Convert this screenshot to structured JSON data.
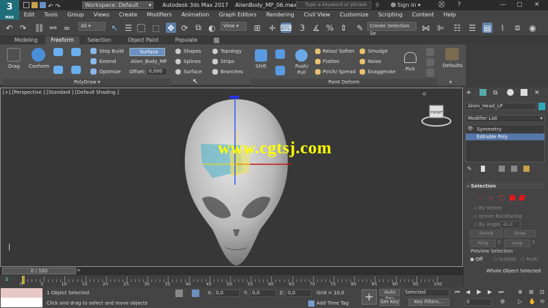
{
  "titlebar": {
    "logo": "3",
    "logo_sub": "MAX",
    "workspace": "Workspace: Default",
    "app_title": "Autodesk 3ds Max 2017",
    "file_name": "AlienBody_MP_06.max",
    "search_placeholder": "Type a keyword or phrase",
    "sign_in": "Sign In"
  },
  "menu": [
    "Edit",
    "Tools",
    "Group",
    "Views",
    "Create",
    "Modifiers",
    "Animation",
    "Graph Editors",
    "Rendering",
    "Civil View",
    "Customize",
    "Scripting",
    "Content",
    "Help"
  ],
  "toolbar": {
    "selection_filter": "All",
    "ref_coord": "View",
    "selection_set": "Create Selection Se"
  },
  "ribbon_tabs": [
    "Modeling",
    "Freeform",
    "Selection",
    "Object Paint",
    "Populate"
  ],
  "ribbon": {
    "drag": "Drag",
    "conform": "Conform",
    "step_build": "Step Build",
    "extend": "Extend",
    "optimize": "Optimize",
    "surface_btn": "Surface",
    "surface_obj": "Alien_Body_MP",
    "offset_label": "Offset:",
    "offset_value": "0,000",
    "shapes": "Shapes",
    "splines": "Splines",
    "surface2": "Surface",
    "topology": "Topology",
    "strips": "Strips",
    "branches": "Branches",
    "shift": "Shift",
    "push_pull": "Push/",
    "push_pull2": "Pull",
    "relax_soften": "Relax/ Soften",
    "flatten": "Flatten",
    "pinch_spread": "Pinch/ Spread",
    "smudge": "Smudge",
    "noise": "Noise",
    "exaggerate": "Exaggerate",
    "pick": "Pick",
    "defaults": "Defaults",
    "group_polydraw": "PolyDraw",
    "group_paint_deform": "Paint Deform"
  },
  "viewport": {
    "label": "[+] [Perspective ] [Standard ] [Default Shading ]",
    "watermark": "www.cgtsj.com",
    "cube_label": "FRONT"
  },
  "timeline": {
    "frame": "0 / 100",
    "ticks": [
      "0",
      "5",
      "10",
      "15",
      "20",
      "25",
      "30",
      "35",
      "40",
      "45",
      "50",
      "55",
      "60",
      "65",
      "70",
      "75",
      "80",
      "85",
      "90",
      "95",
      "100"
    ]
  },
  "status": {
    "selected": "1 Object Selected",
    "prompt": "Click and drag to select and move objects",
    "x_label": "X:",
    "x_val": "0,0",
    "y_label": "Y:",
    "y_val": "0,0",
    "z_label": "Z:",
    "z_val": "0,0",
    "grid": "Grid = 10,0",
    "add_time_tag": "Add Time Tag",
    "auto_key": "Auto Key",
    "selected_dd": "Selected",
    "set_key": "Set Key",
    "key_filters": "Key Filters...",
    "frame_field": "0"
  },
  "command_panel": {
    "object_name": "Alien_Head_LP",
    "modifier_list": "Modifier List",
    "stack": [
      "Symmetry",
      "Editable Poly"
    ],
    "selection_title": "Selection",
    "by_vertex": "By Vertex",
    "ignore_backfacing": "Ignore Backfacing",
    "by_angle": "By Angle:",
    "angle_val": "45,0",
    "shrink": "Shrink",
    "grow": "Grow",
    "ring": "Ring",
    "loop": "Loop",
    "preview_selection": "Preview Selection",
    "off": "Off",
    "subobj": "SubObj",
    "multi": "Multi",
    "whole_object": "Whole Object Selected",
    "accent": "#2fa8b8"
  }
}
